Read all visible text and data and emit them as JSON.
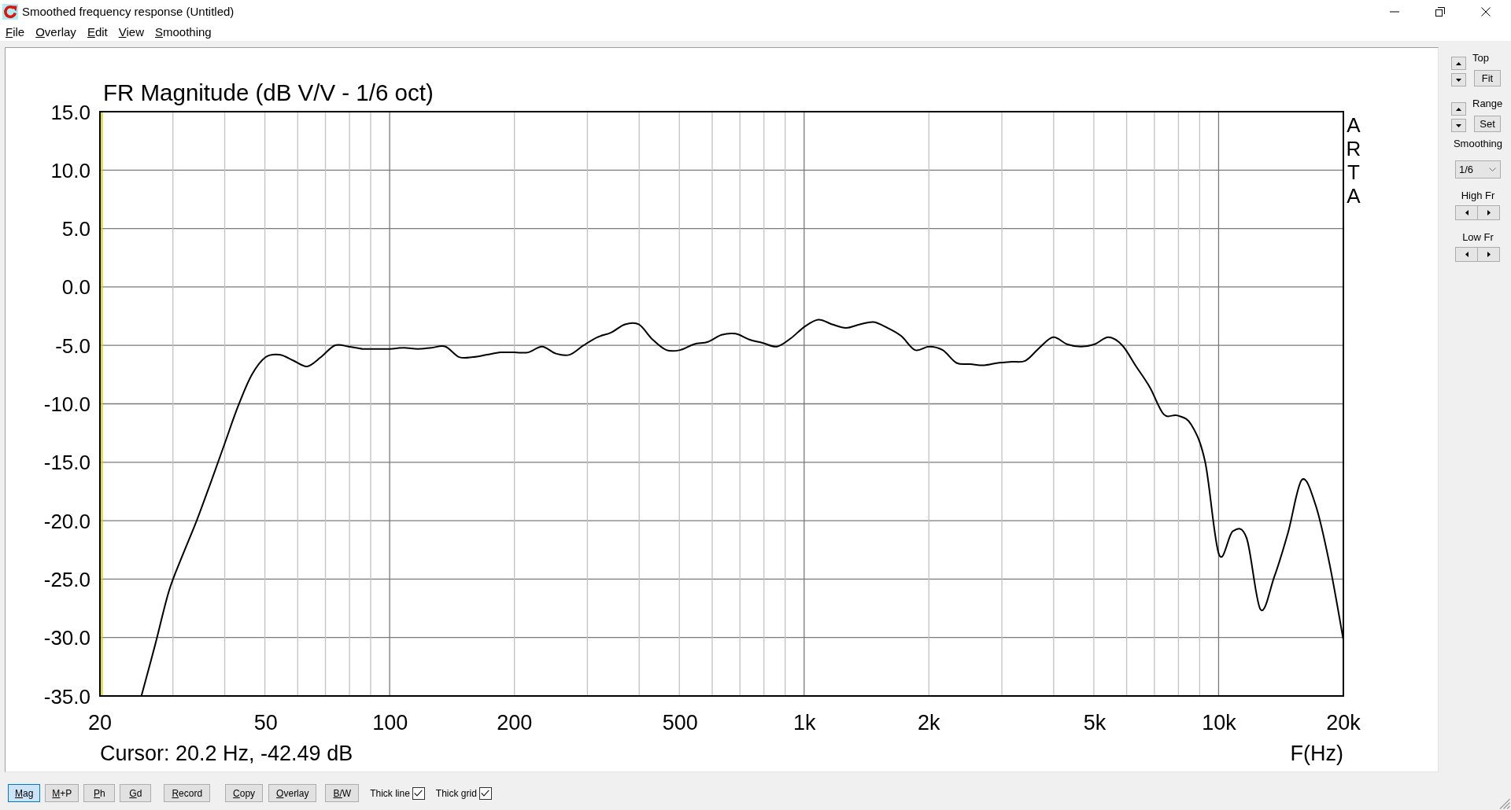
{
  "window": {
    "title": "Smoothed frequency response (Untitled)"
  },
  "menu": [
    "File",
    "Overlay",
    "Edit",
    "View",
    "Smoothing"
  ],
  "graph": {
    "overlay_text": "ARTA",
    "cursor_readout": "Cursor: 20.2 Hz, -42.49 dB",
    "chart_data": {
      "type": "line",
      "title": "FR Magnitude (dB V/V - 1/6 oct)",
      "xlabel": "F(Hz)",
      "ylim": [
        -35,
        15
      ],
      "grid": true,
      "yticks": [
        {
          "value": 15,
          "label": "15.0"
        },
        {
          "value": 10,
          "label": "10.0"
        },
        {
          "value": 5,
          "label": "5.0"
        },
        {
          "value": 0,
          "label": "0.0"
        },
        {
          "value": -5,
          "label": "-5.0"
        },
        {
          "value": -10,
          "label": "-10.0"
        },
        {
          "value": -15,
          "label": "-15.0"
        },
        {
          "value": -20,
          "label": "-20.0"
        },
        {
          "value": -25,
          "label": "-25.0"
        },
        {
          "value": -30,
          "label": "-30.0"
        },
        {
          "value": -35,
          "label": "-35.0"
        }
      ],
      "categories": [
        "20",
        null,
        null,
        null,
        null,
        null,
        null,
        null,
        null,
        null,
        null,
        null,
        "50",
        null,
        null,
        null,
        null,
        null,
        null,
        null,
        null,
        "100",
        null,
        null,
        null,
        null,
        null,
        null,
        null,
        null,
        "200",
        null,
        null,
        null,
        null,
        null,
        null,
        null,
        null,
        null,
        null,
        null,
        "500",
        null,
        null,
        null,
        null,
        null,
        null,
        null,
        null,
        "1k",
        null,
        null,
        null,
        null,
        null,
        null,
        null,
        null,
        "2k",
        null,
        null,
        null,
        null,
        null,
        null,
        null,
        null,
        null,
        null,
        null,
        "5k",
        null,
        null,
        null,
        null,
        null,
        null,
        null,
        null,
        "10k",
        null,
        null,
        null,
        null,
        null,
        null,
        null,
        null,
        "20k"
      ],
      "series": [
        {
          "values": [
            null,
            null,
            null,
            -35,
            -30.6,
            -26.0,
            -22.9,
            -20.0,
            -16.8,
            -13.5,
            -10.2,
            -7.5,
            -6.0,
            -5.8,
            -6.3,
            -6.8,
            -6.0,
            -5.0,
            -5.1,
            -5.3,
            -5.3,
            -5.3,
            -5.2,
            -5.3,
            -5.2,
            -5.1,
            -6.0,
            -6.0,
            -5.8,
            -5.6,
            -5.6,
            -5.6,
            -5.1,
            -5.7,
            -5.8,
            -5.0,
            -4.3,
            -3.9,
            -3.2,
            -3.2,
            -4.5,
            -5.4,
            -5.4,
            -4.9,
            -4.7,
            -4.1,
            -4.0,
            -4.5,
            -4.8,
            -5.1,
            -4.4,
            -3.4,
            -2.8,
            -3.2,
            -3.5,
            -3.2,
            -3.0,
            -3.5,
            -4.2,
            -5.4,
            -5.1,
            -5.4,
            -6.5,
            -6.6,
            -6.7,
            -6.5,
            -6.4,
            -6.3,
            -5.2,
            -4.3,
            -4.9,
            -5.1,
            -4.9,
            -4.3,
            -5.0,
            -6.8,
            -8.6,
            -10.9,
            -11.0,
            -11.8,
            -15.0,
            -22.9,
            -20.9,
            -21.5,
            -27.6,
            -24.8,
            -21.0,
            -16.5,
            -18.7,
            -23.7,
            -30.2
          ]
        }
      ]
    }
  },
  "side_panel": {
    "controls": [
      {
        "kind": "spin",
        "label": "Top",
        "button": "Fit"
      },
      {
        "kind": "spin",
        "label": "Range",
        "button": "Set"
      },
      {
        "kind": "dropdown",
        "label": "Smoothing",
        "value": "1/6"
      },
      {
        "kind": "stepper",
        "label": "High Fr"
      },
      {
        "kind": "stepper",
        "label": "Low Fr"
      }
    ]
  },
  "toolbar": {
    "view_buttons": [
      {
        "label": "Mag",
        "selected": true
      },
      {
        "label": "M+P",
        "selected": false
      },
      {
        "label": "Ph",
        "selected": false
      },
      {
        "label": "Gd",
        "selected": false
      }
    ],
    "action_buttons": [
      "Record",
      "Copy",
      "Overlay",
      "B/W"
    ],
    "checkboxes": [
      {
        "label": "Thick line",
        "checked": true
      },
      {
        "label": "Thick grid",
        "checked": true
      }
    ]
  }
}
